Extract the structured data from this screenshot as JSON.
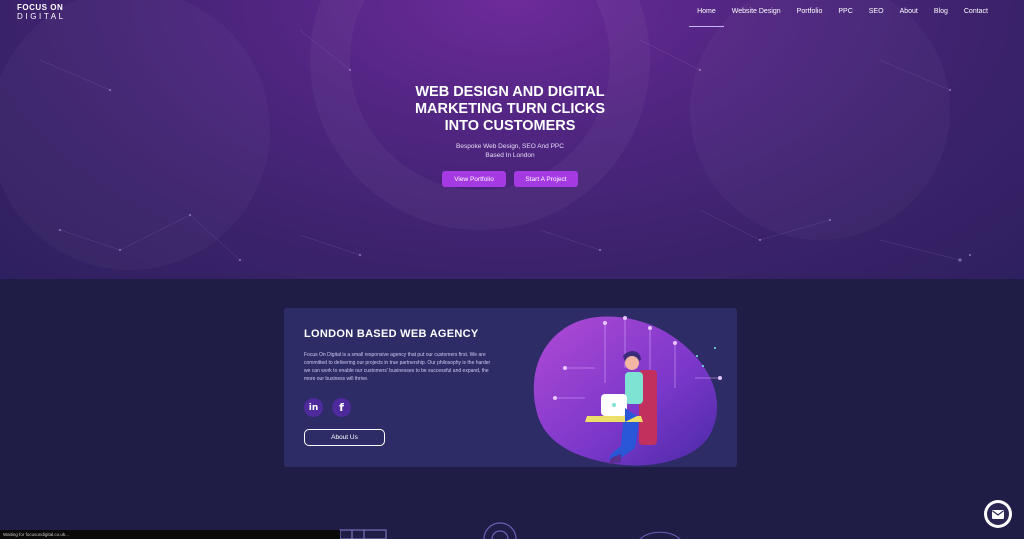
{
  "brand": {
    "line1": "FOCUS ON",
    "line2": "DIGITAL"
  },
  "nav": [
    {
      "label": "Home",
      "active": true
    },
    {
      "label": "Website Design"
    },
    {
      "label": "Portfolio"
    },
    {
      "label": "PPC"
    },
    {
      "label": "SEO"
    },
    {
      "label": "About"
    },
    {
      "label": "Blog"
    },
    {
      "label": "Contact"
    }
  ],
  "hero": {
    "title_lines": [
      "WEB DESIGN AND DIGITAL",
      "MARKETING TURN CLICKS",
      "INTO CUSTOMERS"
    ],
    "subtitle_lines": [
      "Bespoke Web Design, SEO And PPC",
      "Based In London"
    ],
    "buttons": {
      "portfolio": "View Portfolio",
      "project": "Start A Project"
    }
  },
  "agency": {
    "title": "LONDON BASED WEB AGENCY",
    "text": "Focus On Digital is a small responsive agency that put our customers first. We are committed to delivering our projects in true partnership. Our philosophy is the harder we can work to enable our customers' businesses to be successful and expand, the more our business will thrive.",
    "social": {
      "linkedin": "in",
      "facebook": "f"
    },
    "button": "About Us"
  },
  "status_bar": "Waiting for focusondigital.co.uk...",
  "icons": {
    "chat": "envelope-icon",
    "linkedin": "linkedin-icon",
    "facebook": "facebook-icon"
  },
  "colors": {
    "accent": "#a53ae3",
    "hero_bg": "#4f2580",
    "section_bg": "#1f1d45",
    "card_bg": "#2e2c66"
  }
}
